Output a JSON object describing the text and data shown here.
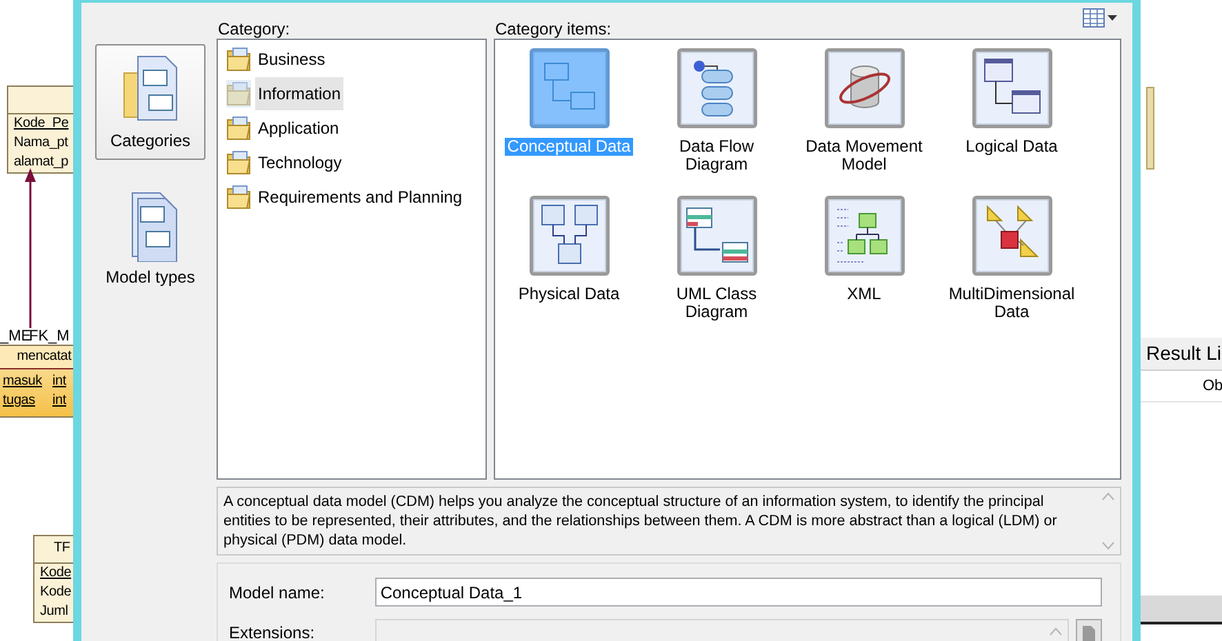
{
  "diagram": {
    "entities": [
      {
        "attributes": [
          {
            "name": "Kode_Pe",
            "identifier": true
          },
          {
            "name": "Nama_pt",
            "identifier": false
          },
          {
            "name": "alamat_p",
            "identifier": false
          }
        ]
      },
      {
        "name": "mencatat",
        "attributes": [
          {
            "name": "masuk",
            "type": "int",
            "identifier": true
          },
          {
            "name": "tugas",
            "type": "int",
            "identifier": true
          }
        ]
      },
      {
        "name": "TF",
        "attributes": [
          {
            "name": "Kode",
            "identifier": true
          },
          {
            "name": "Kode",
            "identifier": false
          },
          {
            "name": "Juml",
            "identifier": false
          }
        ]
      }
    ],
    "link_labels": [
      "_ME",
      "FK_M"
    ]
  },
  "result_list": {
    "title": "Result Li",
    "column": "Ob"
  },
  "dialog": {
    "nav": [
      {
        "label": "Categories",
        "selected": true
      },
      {
        "label": "Model types",
        "selected": false
      }
    ],
    "category": {
      "label": "Category:",
      "items": [
        {
          "label": "Business",
          "selected": false
        },
        {
          "label": "Information",
          "selected": true
        },
        {
          "label": "Application",
          "selected": false
        },
        {
          "label": "Technology",
          "selected": false
        },
        {
          "label": "Requirements and Planning",
          "selected": false
        }
      ]
    },
    "category_items": {
      "label": "Category items:",
      "items": [
        {
          "label": "Conceptual Data",
          "kind": "conceptual",
          "selected": true
        },
        {
          "label": "Data Flow Diagram",
          "kind": "flow",
          "selected": false
        },
        {
          "label": "Data Movement Model",
          "kind": "movement",
          "selected": false
        },
        {
          "label": "Logical Data",
          "kind": "logical",
          "selected": false
        },
        {
          "label": "Physical Data",
          "kind": "physical",
          "selected": false
        },
        {
          "label": "UML Class Diagram",
          "kind": "uml",
          "selected": false
        },
        {
          "label": "XML",
          "kind": "xml",
          "selected": false
        },
        {
          "label": "MultiDimensional Data",
          "kind": "multidim",
          "selected": false
        }
      ]
    },
    "description": "A conceptual data model (CDM) helps you analyze the conceptual structure of an information system, to identify the principal entities to be represented, their attributes, and the relationships between them. A CDM is more abstract than a logical (LDM) or physical (PDM) data model.",
    "model_name": {
      "label": "Model name:",
      "value": "Conceptual Data_1"
    },
    "extensions": {
      "label": "Extensions:",
      "disabled": true
    }
  }
}
